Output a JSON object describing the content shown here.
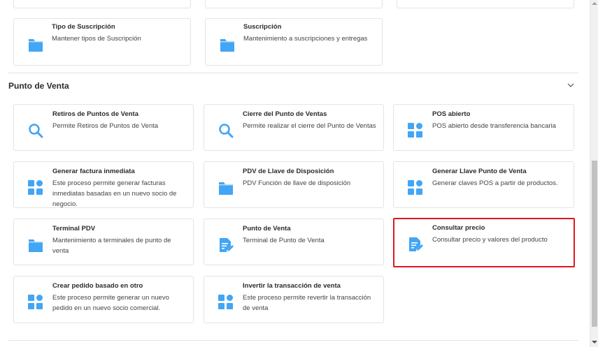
{
  "top_section": {
    "cards": [
      {
        "title": "Tipo de Suscripción",
        "desc": "Mantener tipos de Suscripción",
        "icon": "folder-icon"
      },
      {
        "title": "Suscripción",
        "desc": "Mantenimiento a suscripciones y entregas",
        "icon": "folder-icon"
      }
    ]
  },
  "section": {
    "title": "Punto de Venta",
    "collapse_icon": "chevron-down-icon"
  },
  "cards": [
    {
      "title": "Retiros de Puntos de Venta",
      "desc": "Permite Retiros de Puntos de Venta",
      "icon": "search-icon"
    },
    {
      "title": "Cierre del Punto de Ventas",
      "desc": "Permite realizar el cierre del Punto de Ventas",
      "icon": "search-icon"
    },
    {
      "title": "POS abierto",
      "desc": "POS abierto desde transferencia bancaria",
      "icon": "grid-icon"
    },
    {
      "title": "Generar factura inmediata",
      "desc": "Este proceso permite generar facturas inmediatas basadas en un nuevo socio de negocio.",
      "icon": "grid-icon"
    },
    {
      "title": "PDV de Llave de Disposición",
      "desc": "PDV Función de llave de disposición",
      "icon": "folder-icon"
    },
    {
      "title": "Generar Llave Punto de Venta",
      "desc": "Generar claves POS a partir de productos.",
      "icon": "grid-icon"
    },
    {
      "title": "Terminal PDV",
      "desc": "Mantenimiento a terminales de punto de venta",
      "icon": "folder-icon"
    },
    {
      "title": "Punto de Venta",
      "desc": "Terminal de Punto de Venta",
      "icon": "edit-document-icon"
    },
    {
      "title": "Consultar precio",
      "desc": "Consultar precio y valores del producto",
      "icon": "edit-document-icon"
    },
    {
      "title": "Crear pedido basado en otro",
      "desc": "Este proceso permite generar un nuevo pedido en un nuevo socio comercial.",
      "icon": "grid-icon"
    },
    {
      "title": "Invertir la transacción de venta",
      "desc": "Este proceso permite revertir la transacción de venta",
      "icon": "grid-icon"
    }
  ],
  "colors": {
    "icon": "#42a5f5",
    "selected_border": "#e0161e",
    "card_border": "#e2e4e8"
  }
}
